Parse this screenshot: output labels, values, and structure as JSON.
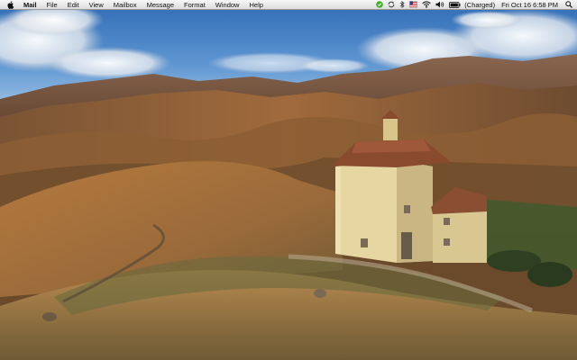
{
  "menubar": {
    "app_name": "Mail",
    "menus": [
      "File",
      "Edit",
      "View",
      "Mailbox",
      "Message",
      "Format",
      "Window",
      "Help"
    ],
    "status": {
      "battery_text": "(Charged)",
      "date_time": "Fri Oct 16  6:58 PM"
    }
  },
  "icons": [
    "apple-icon",
    "skype-icon",
    "sync-icon",
    "bluetooth-icon",
    "flag-icon",
    "wifi-icon",
    "volume-icon",
    "battery-icon",
    "spotlight-icon"
  ],
  "colors": {
    "menubar_bg": "#e9e9e9",
    "skype_green": "#43b02a",
    "sky": "#4a86c8"
  }
}
